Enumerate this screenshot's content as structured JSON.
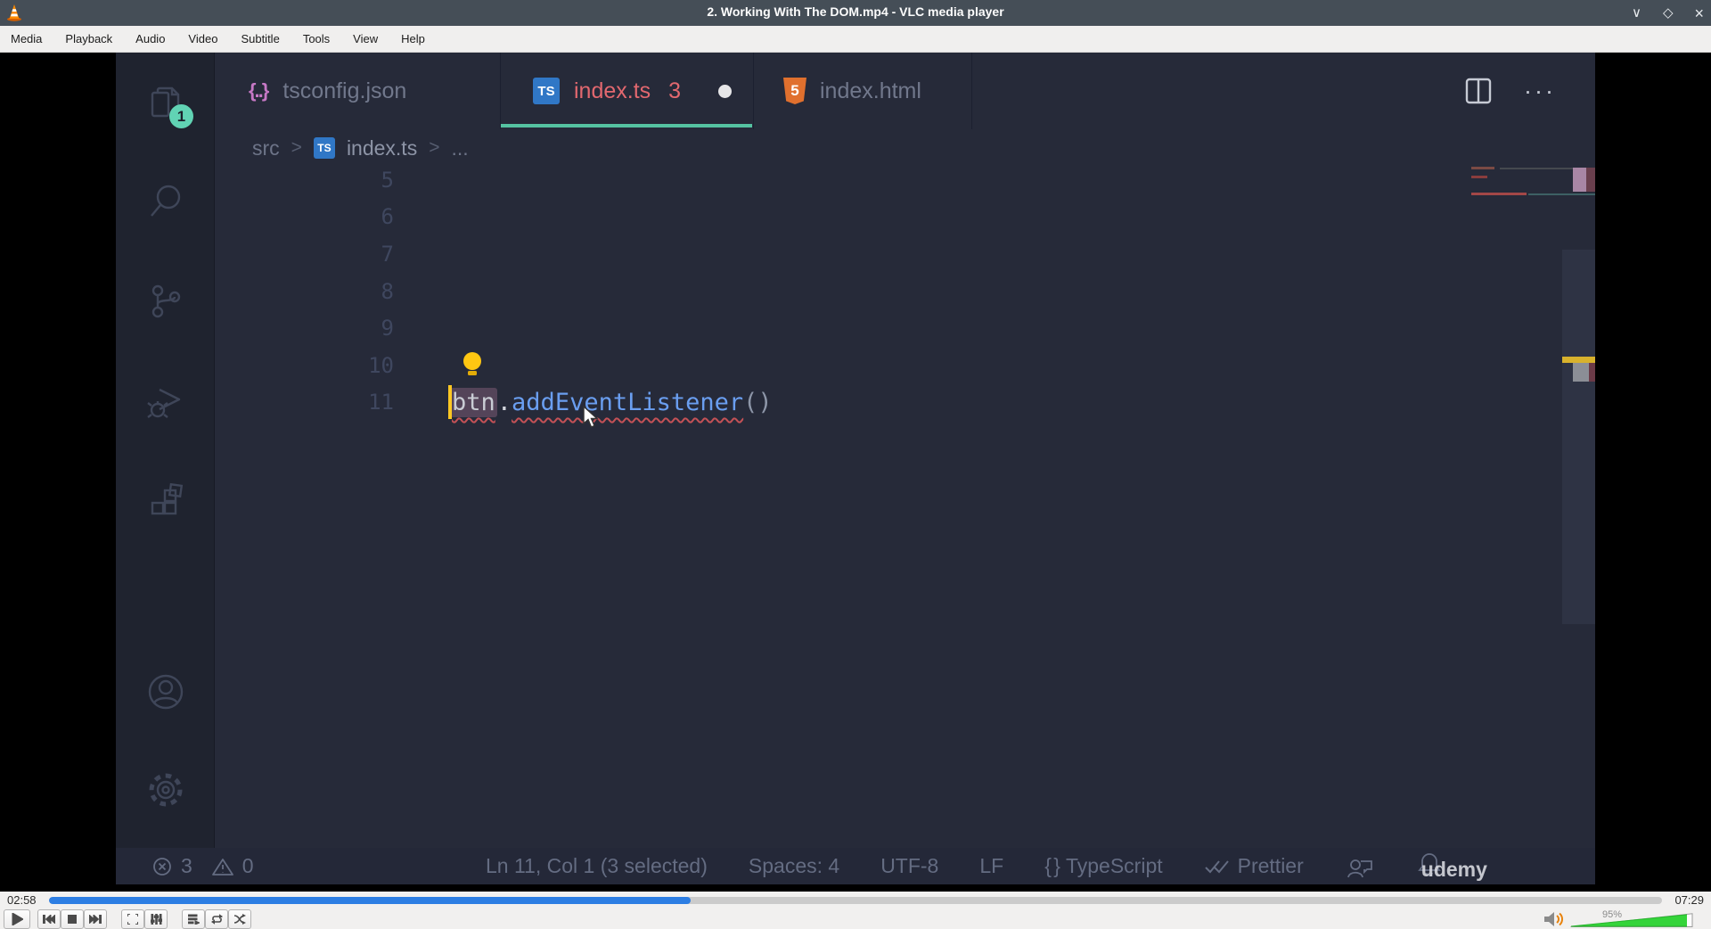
{
  "window": {
    "title": "2. Working With The DOM.mp4 - VLC media player",
    "controls": {
      "minimize": "∨",
      "maximize": "◇",
      "close": "×"
    }
  },
  "menu": {
    "items": [
      "Media",
      "Playback",
      "Audio",
      "Video",
      "Subtitle",
      "Tools",
      "View",
      "Help"
    ]
  },
  "vlc": {
    "elapsed": "02:58",
    "duration": "07:29",
    "progress_percent": 39.8,
    "volume_percent": 95,
    "volume_label": "95%",
    "seek_color": "#2d7ee3",
    "volume_color": "#35d43a"
  },
  "vscode": {
    "activity_badge": "1",
    "tabs": [
      {
        "name": "tsconfig.json"
      },
      {
        "name": "index.ts",
        "problems": "3"
      },
      {
        "name": "index.html"
      }
    ],
    "tab_icons": {
      "json": "{..}",
      "ts": "TS",
      "html": "5"
    },
    "editor_actions": {
      "more": "···"
    },
    "breadcrumb": {
      "root": "src",
      "sep1": ">",
      "file": "index.ts",
      "sep2": ">",
      "more": "..."
    },
    "line_numbers": [
      "5",
      "6",
      "7",
      "8",
      "9",
      "10",
      "11"
    ],
    "code": {
      "object": "btn",
      "accessor": ".",
      "method": "addEventListener",
      "args": "()"
    },
    "status": {
      "errors": "3",
      "warnings": "0",
      "position": "Ln 11, Col 1 (3 selected)",
      "indent": "Spaces: 4",
      "encoding": "UTF-8",
      "eol": "LF",
      "language_icon": "{ }",
      "language": "TypeScript",
      "formatter": "Prettier",
      "watermark": "udemy"
    },
    "colors": {
      "accent_teal": "#55c3a2",
      "tab_error_red": "#e2686f",
      "ts_blue": "#3077c6",
      "html_orange": "#e0702e",
      "json_pink": "#c678c5",
      "method_blue": "#6a9ef0",
      "cursor_yellow": "#ffc823",
      "lightbulb_yellow": "#ffc712"
    }
  }
}
